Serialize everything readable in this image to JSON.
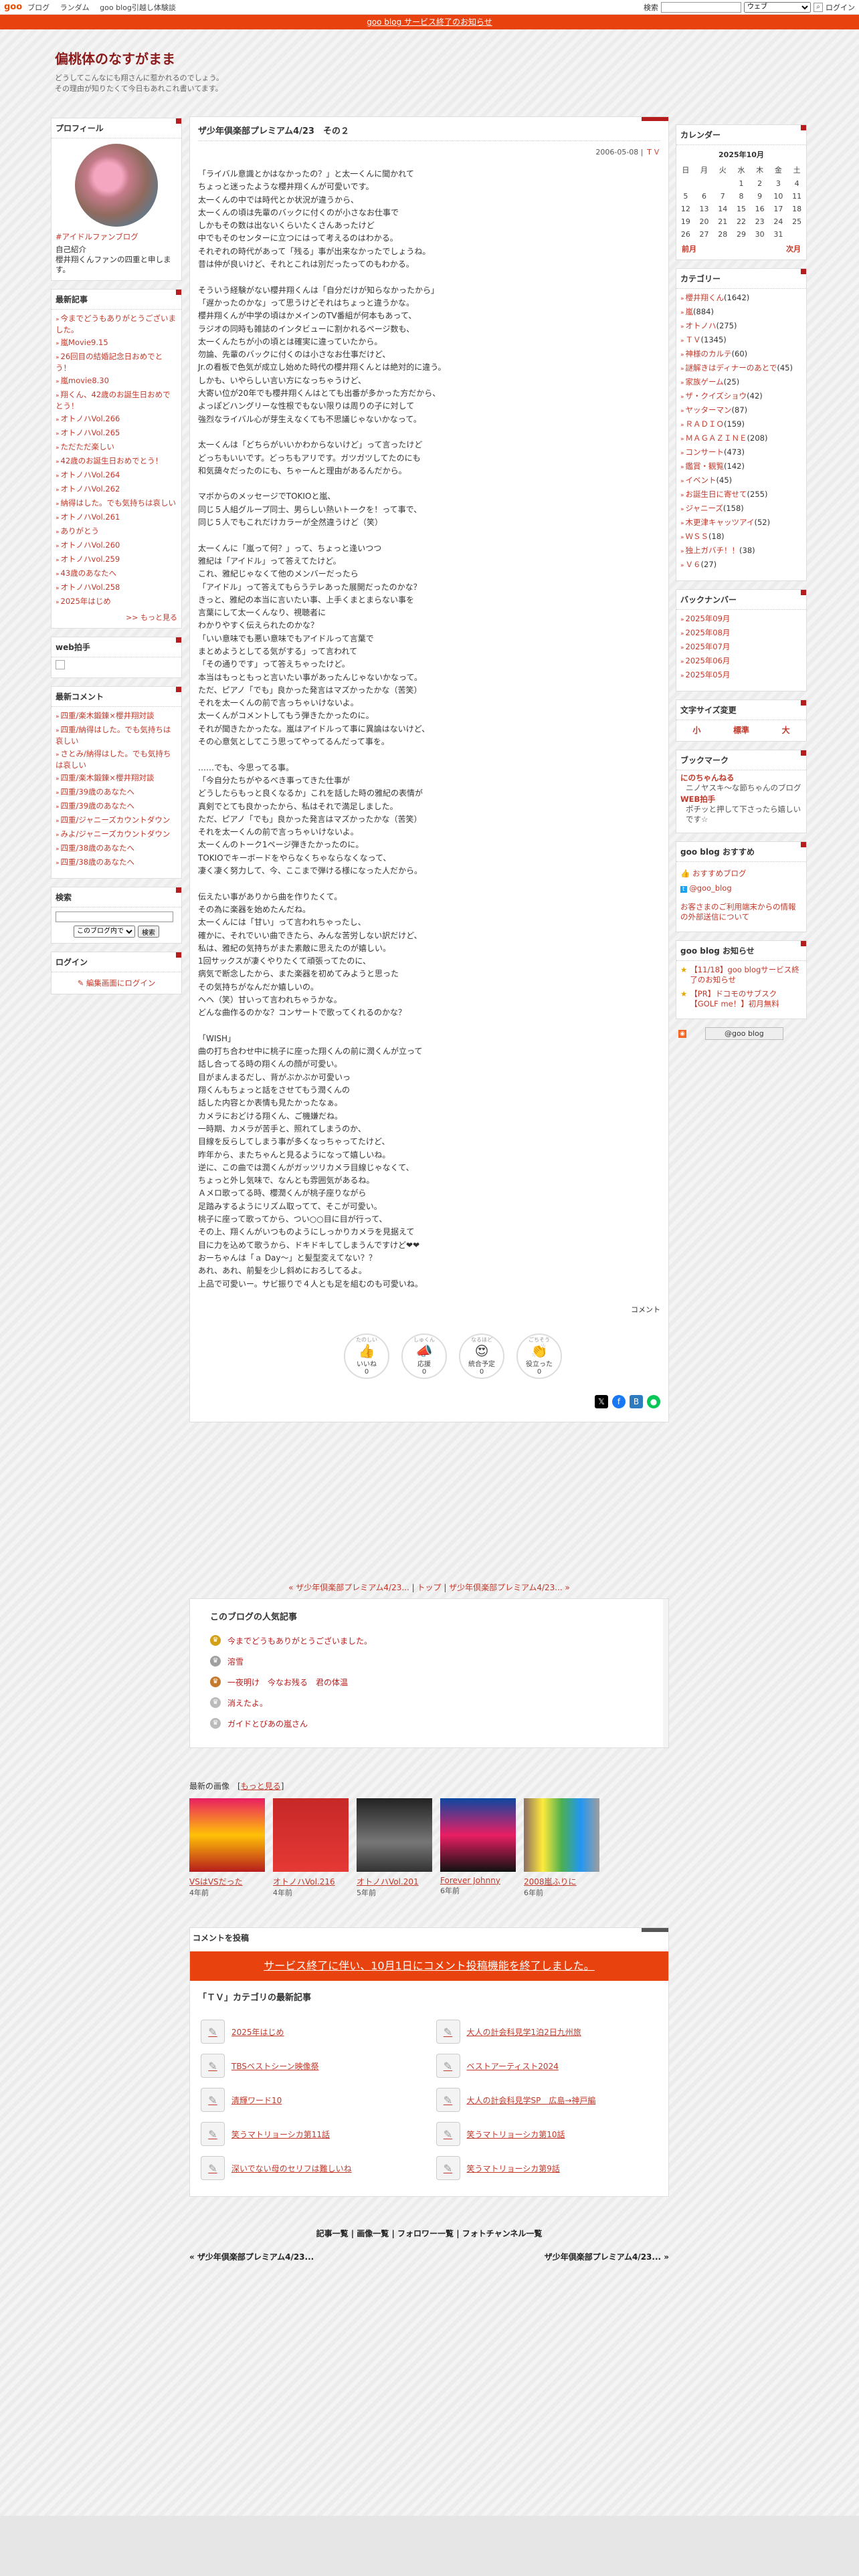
{
  "topbar": {
    "logo": "goo",
    "nav": [
      "ブログ",
      "ランダム",
      "goo blog引越し体験談"
    ],
    "search_label": "検索",
    "search_option": "ウェブ",
    "login": "ログイン"
  },
  "notice": "goo blog サービス終了のお知らせ",
  "header": {
    "title": "偏桃体のなすがまま",
    "desc1": "どうしてこんなにも翔さんに惹かれるのでしょう。",
    "desc2": "その理由が知りたくて今日もあれこれ書いてます。"
  },
  "profile": {
    "heading": "プロフィール",
    "tag": "#アイドルファンブログ",
    "label": "自己紹介",
    "text": "櫻井翔くんファンの四重と申します。"
  },
  "recent_posts": {
    "heading": "最新記事",
    "items": [
      "今までどうもありがとうございました。",
      "嵐Movie9.15",
      "26回目の結婚記念日おめでとう！",
      "嵐movie8.30",
      "翔くん、42歳のお誕生日おめでとう！",
      "オトノハVol.266",
      "オトノハVol.265",
      "ただただ楽しい",
      "42歳のお誕生日おめでとう！",
      "オトノハVol.264",
      "オトノハVol.262",
      "納得はした。でも気持ちは哀しい",
      "オトノハVol.261",
      "ありがとう",
      "オトノハVol.260",
      "オトノハvol.259",
      "43歳のあなたへ",
      "オトノハVol.258",
      "2025年はじめ"
    ],
    "more": ">> もっと見る"
  },
  "web_clap": {
    "heading": "web拍手"
  },
  "recent_comments": {
    "heading": "最新コメント",
    "items": [
      "四重/楽木鍛錬×櫻井翔対談",
      "四重/納得はした。でも気持ちは哀しい",
      "さとみ/納得はした。でも気持ちは哀しい",
      "四重/楽木鍛錬×櫻井翔対談",
      "四重/39歳のあなたへ",
      "四重/39歳のあなたへ",
      "四重/ジャニーズカウントダウン",
      "みよ/ジャニーズカウントダウン",
      "四重/38歳のあなたへ",
      "四重/38歳のあなたへ"
    ]
  },
  "search": {
    "heading": "検索",
    "scope": "このブログ内で",
    "button": "検索"
  },
  "login_box": {
    "heading": "ログイン",
    "link": "編集画面にログイン"
  },
  "calendar": {
    "heading": "カレンダー",
    "month": "2025年10月",
    "weekdays": [
      "日",
      "月",
      "火",
      "水",
      "木",
      "金",
      "土"
    ],
    "weeks": [
      [
        "",
        "",
        "",
        "1",
        "2",
        "3",
        "4"
      ],
      [
        "5",
        "6",
        "7",
        "8",
        "9",
        "10",
        "11"
      ],
      [
        "12",
        "13",
        "14",
        "15",
        "16",
        "17",
        "18"
      ],
      [
        "19",
        "20",
        "21",
        "22",
        "23",
        "24",
        "25"
      ],
      [
        "26",
        "27",
        "28",
        "29",
        "30",
        "31",
        ""
      ]
    ],
    "prev": "前月",
    "next": "次月"
  },
  "categories": {
    "heading": "カテゴリー",
    "items": [
      {
        "name": "櫻井翔くん",
        "count": "(1642)"
      },
      {
        "name": "嵐",
        "count": "(884)"
      },
      {
        "name": "オトノハ",
        "count": "(275)"
      },
      {
        "name": "ＴＶ",
        "count": "(1345)"
      },
      {
        "name": "神様のカルテ",
        "count": "(60)"
      },
      {
        "name": "謎解きはディナーのあとで",
        "count": "(45)"
      },
      {
        "name": "家族ゲーム",
        "count": "(25)"
      },
      {
        "name": "ザ・クイズショウ",
        "count": "(42)"
      },
      {
        "name": "ヤッターマン",
        "count": "(87)"
      },
      {
        "name": "ＲＡＤＩＯ",
        "count": "(159)"
      },
      {
        "name": "ＭＡＧＡＺＩＮＥ",
        "count": "(208)"
      },
      {
        "name": "コンサート",
        "count": "(473)"
      },
      {
        "name": "鑑賞・観覧",
        "count": "(142)"
      },
      {
        "name": "イベント",
        "count": "(45)"
      },
      {
        "name": "お誕生日に寄せて",
        "count": "(255)"
      },
      {
        "name": "ジャニーズ",
        "count": "(158)"
      },
      {
        "name": "木更津キャッツアイ",
        "count": "(52)"
      },
      {
        "name": "ＷＳＳ",
        "count": "(18)"
      },
      {
        "name": "独上ガバチ！！",
        "count": "(38)"
      },
      {
        "name": "Ｖ６",
        "count": "(27)"
      }
    ]
  },
  "backnumber": {
    "heading": "バックナンバー",
    "items": [
      "2025年09月",
      "2025年08月",
      "2025年07月",
      "2025年06月",
      "2025年05月"
    ]
  },
  "fontsize": {
    "heading": "文字サイズ変更",
    "small": "小",
    "normal": "標準",
    "large": "大"
  },
  "bookmarks": {
    "heading": "ブックマーク",
    "items": [
      {
        "title": "にのちゃんねる",
        "desc": "ニノヤスキ～な節ちゃんのブログ"
      },
      {
        "title": "WEB拍手",
        "desc": "ポチッと押して下さったら嬉しいです☆"
      }
    ]
  },
  "goo_recommend": {
    "heading": "goo blog おすすめ",
    "items": [
      "おすすめブログ",
      "@goo_blog"
    ],
    "note": "お客さまのご利用端末からの情報の外部送信について"
  },
  "goo_notice": {
    "heading": "goo blog お知らせ",
    "items": [
      "【11/18】goo blogサービス終了のお知らせ",
      "【PR】ドコモのサブスク【GOLF me！】初月無料"
    ],
    "badge": "@goo blog"
  },
  "post": {
    "title": "ザ少年倶楽部プレミアム4/23　その２",
    "date": "2006-05-08",
    "category": "ＴＶ",
    "lines": [
      "「ライバル意識とかはなかったの？」と太一くんに聞かれて",
      "ちょっと迷ったような櫻井翔くんが可愛いです。",
      "太一くんの中では時代とか状況が違うから、",
      "太一くんの頃は先輩のバックに付くのが小さなお仕事で",
      "しかもその数は出ないくらいたくさんあったけど",
      "中でもそのセンターに立つにはって考えるのはわかる。",
      "それぞれの時代があって「残る」事が出来なかったでしょうね。",
      "昔は仲が良いけど、それとこれは別だったってのもわかる。",
      "",
      "そういう経験がない櫻井翔くんは「自分だけが知らなかったから」",
      "「遅かったのかな」って思うけどそれはちょっと違うかな。",
      "櫻井翔くんが中学の頃はかメインのTV番組が何本もあって、",
      "ラジオの同時も雑誌のインタビューに割かれるページ数も、",
      "太一くんたちが小の頃とは確実に違っていたから。",
      "勿論、先輩のバックに付くのは小さなお仕事だけど、",
      "Jr.の看板で色気が成立し始めた時代の櫻井翔くんとは絶対的に違う。",
      "しかも、いやらしい言い方になっちゃうけど、",
      "大寄い位が20年でも櫻井翔くんはとても出番が多かった方だから、",
      "よっぽどハングリーな性根でもない限りは周りの子に対して",
      "強烈なライバル心が芽生えなくても不思議じゃないかなって。",
      "",
      "太一くんは「どちらがいいかわからないけど」って言ったけど",
      "どっちもいいです。どっちもアリです。ガツガツしてたのにも",
      "和気藹々だったのにも、ちゃーんと理由があるんだから。",
      "",
      "マボからのメッセージでTOKIOと嵐、",
      "同じ５人組グループ同士、男らしい熱いトークを！って事で、",
      "同じ５人でもこれだけカラーが全然違うけど（笑）",
      "",
      "太一くんに「嵐って何？」って、ちょっと逢いつつ",
      "雅紀は「アイドル」って答えてたけど。",
      "これ、雅紀じゃなくて他のメンバーだったら",
      "「アイドル」って答えてもらうテレあった展開だったのかな？",
      "きっと、雅紀の本当に言いたい事、上手くまとまらない事を",
      "言葉にして太一くんなり、視聴者に",
      "わかりやすく伝えられたのかな？",
      "「いい意味でも悪い意味でもアイドルって言葉で",
      "まとめようとしてる気がする」って言われて",
      "「その通りです」って答えちゃったけど。",
      "本当はもっともっと言いたい事があったんじゃないかなって。",
      "ただ、ピアノ「でも」良かった発言はマズかったかな（苦笑）",
      "それを太一くんの前で言っちゃいけないよ。",
      "太一くんがコメントしてもう弾きたかったのに。",
      "それが聞きたかったな。嵐はアイドルって事に異論はないけど、",
      "その心意気としてこう思ってやってるんだって事を。",
      "",
      "……でも、今思ってる事。",
      "「今自分たちがやるべき事ってきた仕事が",
      "どうしたらもっと良くなるか」これを話した時の雅紀の表情が",
      "真剣でとても良かったから、私はそれで満足しました。",
      "ただ、ピアノ「でも」良かった発言はマズかったかな（苦笑）",
      "それを太一くんの前で言っちゃいけないよ。",
      "太一くんのトーク1ページ弾きたかったのに。",
      "TOKIOでキーボードをやらなくちゃならなくなって、",
      "凄く凄く努力して、今、ここまで弾ける様になった人だから。",
      "",
      "伝えたい事がありから曲を作りたくて。",
      "その為に楽器を始めたんだね。",
      "太一くんには「甘い」って言われちゃったし、",
      "確かに、それでいい曲できたら、みんな苦労しない訳だけど、",
      "私は、雅紀の気持ちがまた素敵に思えたのが嬉しい。",
      "1回サックスが凄くやりたくて頑張ってたのに、",
      "病気で断念したから、また楽器を初めてみようと思った",
      "その気持ちがなんだか嬉しいの。",
      "ヘヘ（笑）甘いって言われちゃうかな。",
      "どんな曲作るのかな？コンサートで歌ってくれるのかな？",
      "",
      "「WISH」",
      "曲の打ち合わせ中に桃子に座った翔くんの前に潤くんが立って",
      "話し合ってる時の翔くんの顔が可愛い。",
      "目がまんまるだし、背がぶかぶか可愛いっ",
      "翔くんもちょっと話をさせてもう潤くんの",
      "話した内容とか表情も見たかったなぁ。",
      "カメラにおどける翔くん、ご機嫌だね。",
      "一時期、カメラが苦手と、照れてしまうのか、",
      "目線を反らしてしまう事が多くなっちゃってたけど、",
      "昨年から、またちゃんと見るようになって嬉しいね。",
      "逆に、この曲では潤くんがガッツリカメラ目線じゃなくて、",
      "ちょっと外し気味で、なんとも雰囲気があるね。",
      "Ａメロ歌ってる時、櫻潤くんが桃子座りながら",
      "足踏みするようにリズム取ってて、そこが可愛い。",
      "桃子に座って歌ってから、つい○○目に目が行って、",
      "その上、翔くんがいつものようにしっかりカメラを見据えて",
      "目に力を込めて歌うから、ドキドキしてしまうんですけど❤❤",
      "おーちゃんは「ａ Day～」と髪型変えてない？？",
      "あれ、あれ、前髪を少し斜めにおろしてるよ。",
      "上品で可愛いー。サビ振りで４人とも足を組むのも可愛いね。"
    ],
    "comment_link": "コメント",
    "reactions": [
      {
        "tag": "たのしい",
        "label": "いいね",
        "count": "0",
        "emoji": "👍"
      },
      {
        "tag": "しゅくん",
        "label": "応援",
        "count": "0",
        "emoji": "📣"
      },
      {
        "tag": "なるほど",
        "label": "統合予定",
        "count": "0",
        "emoji": "😍"
      },
      {
        "tag": "ごちそう",
        "label": "役立った",
        "count": "0",
        "emoji": "👏"
      }
    ]
  },
  "pager": {
    "prev": "« ザ少年倶楽部プレミアム4/23...",
    "top": "トップ",
    "next": "ザ少年倶楽部プレミアム4/23... »"
  },
  "popular": {
    "heading": "このブログの人気記事",
    "items": [
      "今までどうもありがとうございました。",
      "溶雪",
      "一夜明け　今なお残る　君の体温",
      "消えたよ。",
      "ガイドとびあの嵐さん"
    ]
  },
  "recent_images": {
    "heading": "最新の画像",
    "more": "もっと見る",
    "items": [
      {
        "title": "VSはVSだった",
        "age": "4年前"
      },
      {
        "title": "オトノハVol.216",
        "age": "4年前"
      },
      {
        "title": "オトノハVol.201",
        "age": "5年前"
      },
      {
        "title": "Forever Johnny",
        "age": "6年前"
      },
      {
        "title": "2008嵐ふりに",
        "age": "6年前"
      }
    ]
  },
  "comment_form": {
    "heading": "コメントを投稿",
    "closed": "サービス終了に伴い、10月1日にコメント投稿機能を終了しました。"
  },
  "cat_latest": {
    "heading": "「ＴＶ」カテゴリの最新記事",
    "items": [
      "2025年はじめ",
      "大人の計会科見学1泊2日九州旅",
      "TBSベストシーン映像祭",
      "ベストアーティスト2024",
      "清輝ワード10",
      "大人の計会科見学SP　広島→神戸編",
      "笑うマトリョーシカ第11話",
      "笑うマトリョーシカ第10話",
      "深いでない母のセリフは難しいね",
      "笑うマトリョーシカ第9話"
    ]
  },
  "footer": {
    "nav": "記事一覧 | 画像一覧 | フォロワー一覧 | フォトチャンネル一覧",
    "prev": "« ザ少年倶楽部プレミアム4/23...",
    "next": "ザ少年倶楽部プレミアム4/23... »"
  }
}
